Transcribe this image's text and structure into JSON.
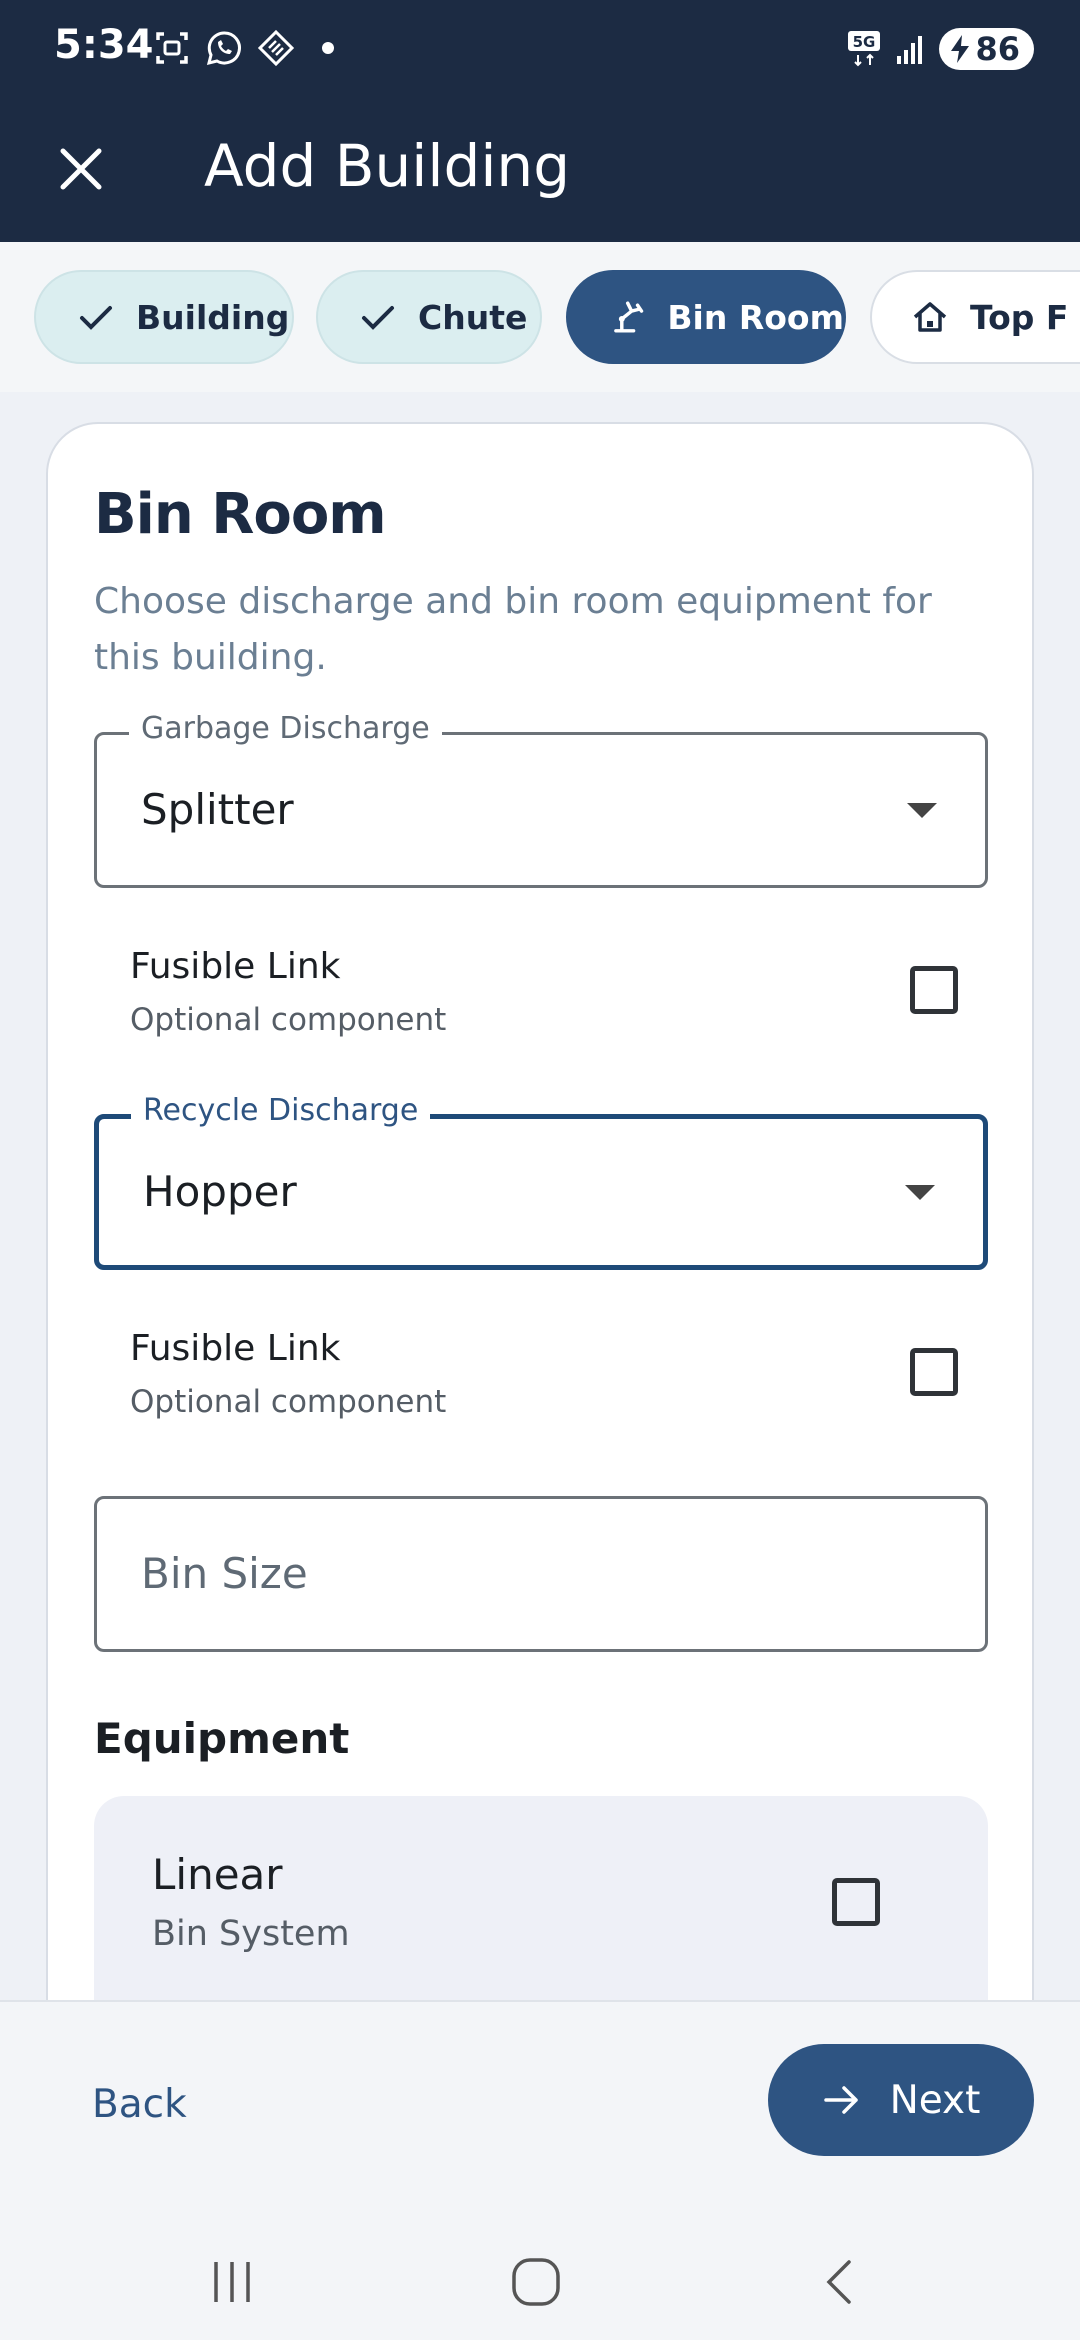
{
  "status_bar": {
    "time": "5:34",
    "network": "5G",
    "battery": "86",
    "icons": [
      "screenshot-icon",
      "whatsapp-icon",
      "app-icon"
    ]
  },
  "app_bar": {
    "title": "Add Building",
    "close_icon": "close-icon"
  },
  "steps": [
    {
      "label": "Building",
      "state": "done",
      "icon": "check-icon"
    },
    {
      "label": "Chute",
      "state": "done",
      "icon": "check-icon"
    },
    {
      "label": "Bin Room",
      "state": "active",
      "icon": "robot-arm-icon"
    },
    {
      "label": "Top F",
      "state": "upcoming",
      "icon": "house-icon"
    }
  ],
  "card": {
    "title": "Bin Room",
    "description": "Choose discharge and bin room equipment for this building.",
    "garbage_discharge": {
      "label": "Garbage Discharge",
      "value": "Splitter"
    },
    "garbage_fusible": {
      "title": "Fusible Link",
      "subtitle": "Optional component",
      "checked": false
    },
    "recycle_discharge": {
      "label": "Recycle Discharge",
      "value": "Hopper"
    },
    "recycle_fusible": {
      "title": "Fusible Link",
      "subtitle": "Optional component",
      "checked": false
    },
    "bin_size": {
      "placeholder": "Bin Size"
    },
    "equipment_title": "Equipment",
    "equipment": [
      {
        "title": "Linear",
        "subtitle": "Bin System",
        "checked": false
      }
    ]
  },
  "footer": {
    "back_label": "Back",
    "next_label": "Next"
  },
  "colors": {
    "primary": "#2e5482",
    "header": "#1c2b43",
    "done_tab": "#dbeef0"
  }
}
